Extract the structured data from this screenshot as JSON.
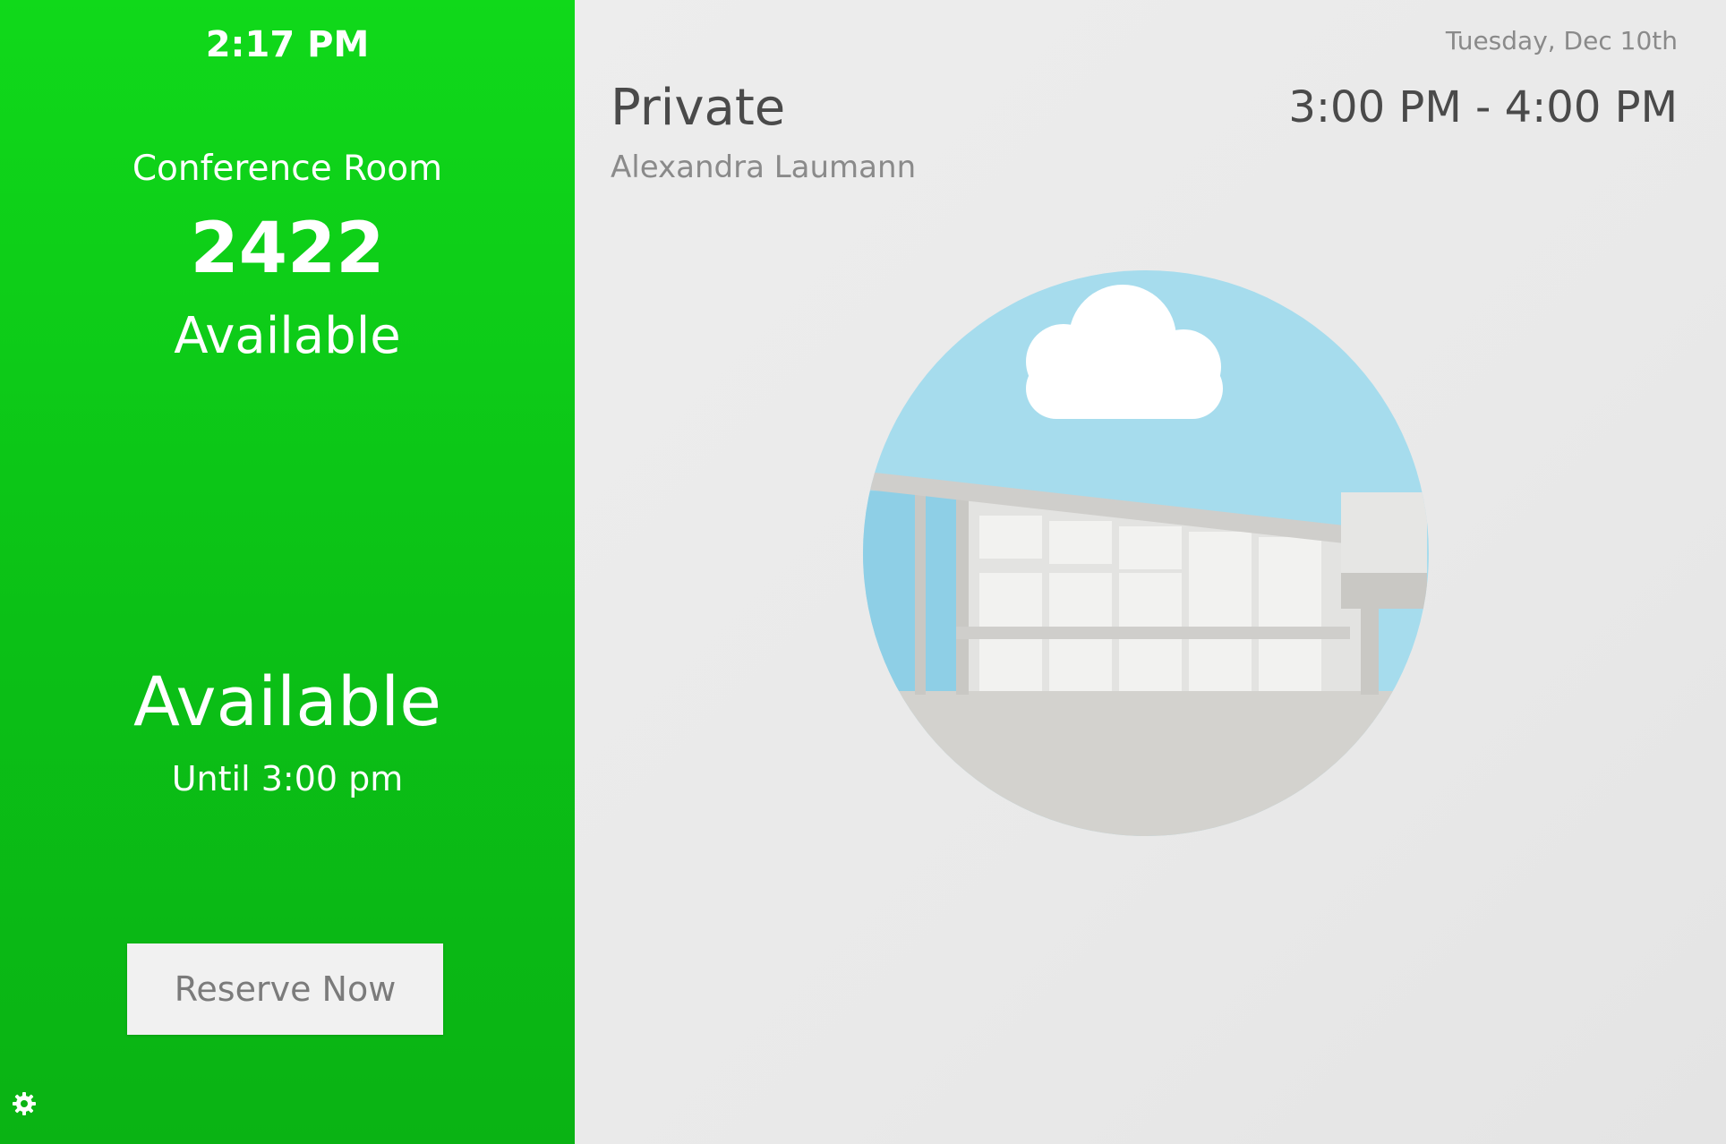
{
  "status_panel": {
    "clock": "2:17 PM",
    "room_label": "Conference Room",
    "room_number": "2422",
    "room_status": "Available",
    "big_status": "Available",
    "until": "Until 3:00 pm",
    "reserve_button": "Reserve Now",
    "settings_icon": "gear-icon",
    "background_color": "#10d91a"
  },
  "details_panel": {
    "date": "Tuesday, Dec 10th",
    "meeting_title": "Private",
    "organizer": "Alexandra Laumann",
    "meeting_time": "3:00 PM - 4:00 PM",
    "illustration_icon": "building-cloud-illustration"
  }
}
